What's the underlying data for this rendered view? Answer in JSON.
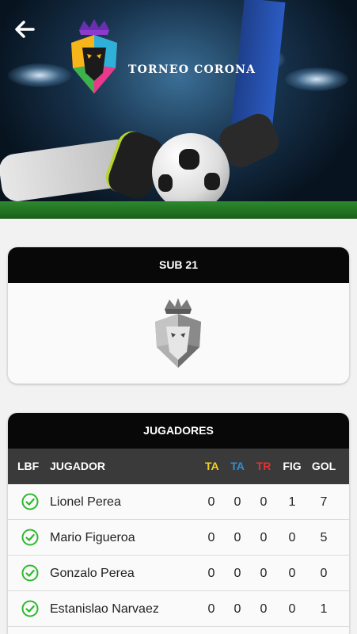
{
  "header": {
    "brand": "TORNEO CORONA",
    "colors": {
      "dark": "#080808",
      "check": "#2eb82e",
      "ta_yellow": "#f2d21b",
      "ta_blue": "#2f8fd8",
      "tr_red": "#e53030"
    }
  },
  "team": {
    "title": "SUB 21"
  },
  "players": {
    "title": "JUGADORES",
    "columns": {
      "lbf": "LBF",
      "jugador": "JUGADOR",
      "ta1": "TA",
      "ta2": "TA",
      "tr": "TR",
      "fig": "FIG",
      "gol": "GOL"
    },
    "rows": [
      {
        "name": "Lionel Perea",
        "ta1": "0",
        "ta2": "0",
        "tr": "0",
        "fig": "1",
        "gol": "7"
      },
      {
        "name": "Mario Figueroa",
        "ta1": "0",
        "ta2": "0",
        "tr": "0",
        "fig": "0",
        "gol": "5"
      },
      {
        "name": "Gonzalo Perea",
        "ta1": "0",
        "ta2": "0",
        "tr": "0",
        "fig": "0",
        "gol": "0"
      },
      {
        "name": "Estanislao Narvaez",
        "ta1": "0",
        "ta2": "0",
        "tr": "0",
        "fig": "0",
        "gol": "1"
      }
    ]
  }
}
